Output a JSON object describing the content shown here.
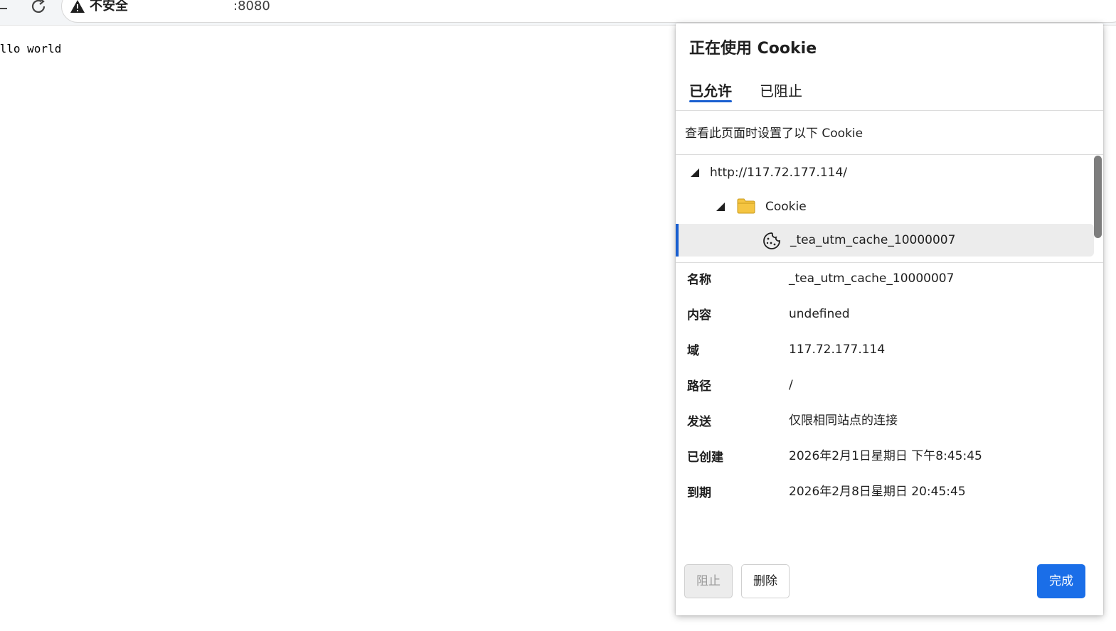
{
  "browser": {
    "security_label": "不安全",
    "url": ":8080"
  },
  "page": {
    "text": "ello world"
  },
  "dialog": {
    "title": "正在使用 Cookie",
    "tabs": [
      {
        "label": "已允许",
        "active": true
      },
      {
        "label": "已阻止",
        "active": false
      }
    ],
    "description": "查看此页面时设置了以下 Cookie",
    "tree": {
      "site": "http://117.72.177.114/",
      "folder": "Cookie",
      "cookie": "_tea_utm_cache_10000007"
    },
    "details": [
      {
        "label": "名称",
        "value": "_tea_utm_cache_10000007"
      },
      {
        "label": "内容",
        "value": "undefined"
      },
      {
        "label": "域",
        "value": "117.72.177.114"
      },
      {
        "label": "路径",
        "value": "/"
      },
      {
        "label": "发送",
        "value": "仅限相同站点的连接"
      },
      {
        "label": "已创建",
        "value": "2026年2月1日星期日 下午8:45:45"
      },
      {
        "label": "到期",
        "value": "2026年2月8日星期日 20:45:45"
      }
    ],
    "buttons": {
      "block": "阻止",
      "delete": "删除",
      "done": "完成"
    },
    "colors": {
      "accent": "#1a6ee8",
      "folder": "#f5c542"
    }
  }
}
